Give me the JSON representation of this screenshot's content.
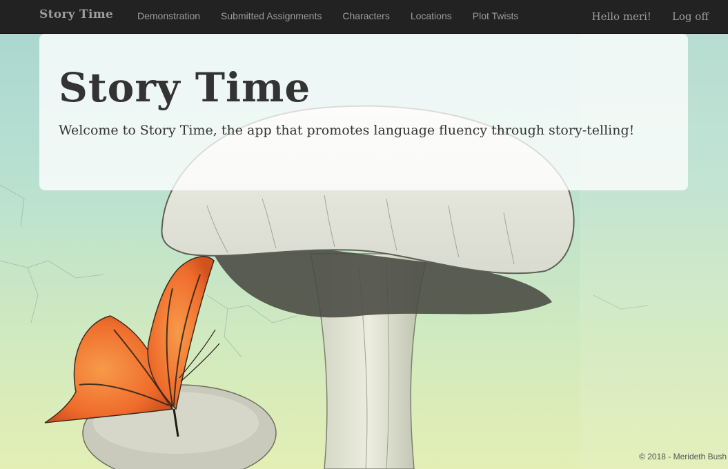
{
  "nav": {
    "brand": "Story Time",
    "links": [
      "Demonstration",
      "Submitted Assignments",
      "Characters",
      "Locations",
      "Plot Twists"
    ],
    "greeting": "Hello meri!",
    "logoff": "Log off"
  },
  "jumbotron": {
    "title": "Story Time",
    "lead": "Welcome to Story Time, the app that promotes language fluency through story-telling!"
  },
  "footer": {
    "copyright": "© 2018 - Merideth Bush"
  },
  "colors": {
    "navbar_bg": "#222222",
    "nav_text": "#9d9d9d",
    "heading_text": "#333333",
    "butterfly_orange": "#ef7f3a"
  },
  "background_image": "mushroom-butterfly-illustration"
}
